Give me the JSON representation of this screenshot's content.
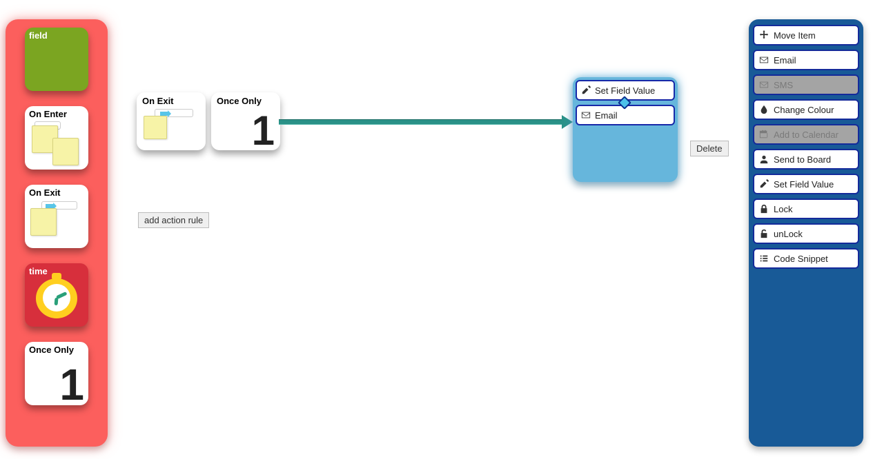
{
  "left_palette": {
    "field_label": "field",
    "on_enter_label": "On Enter",
    "on_exit_label": "On Exit",
    "time_label": "time",
    "once_only_label": "Once\nOnly"
  },
  "canvas": {
    "trigger": {
      "label": "On Exit"
    },
    "guard": {
      "label": "Once\nOnly"
    },
    "target_actions": [
      {
        "icon": "edit",
        "label": "Set Field Value"
      },
      {
        "icon": "envelope",
        "label": "Email"
      }
    ],
    "delete_button": "Delete",
    "add_rule_button": "add action rule"
  },
  "right_palette": {
    "items": [
      {
        "icon": "move",
        "label": "Move Item",
        "enabled": true
      },
      {
        "icon": "envelope",
        "label": "Email",
        "enabled": true
      },
      {
        "icon": "envelope",
        "label": "SMS",
        "enabled": false
      },
      {
        "icon": "tint",
        "label": "Change Colour",
        "enabled": true
      },
      {
        "icon": "calendar",
        "label": "Add to Calendar",
        "enabled": false
      },
      {
        "icon": "user",
        "label": "Send to Board",
        "enabled": true
      },
      {
        "icon": "edit",
        "label": "Set Field Value",
        "enabled": true
      },
      {
        "icon": "lock",
        "label": "Lock",
        "enabled": true
      },
      {
        "icon": "unlock",
        "label": "unLock",
        "enabled": true
      },
      {
        "icon": "list",
        "label": "Code Snippet",
        "enabled": true
      }
    ]
  }
}
